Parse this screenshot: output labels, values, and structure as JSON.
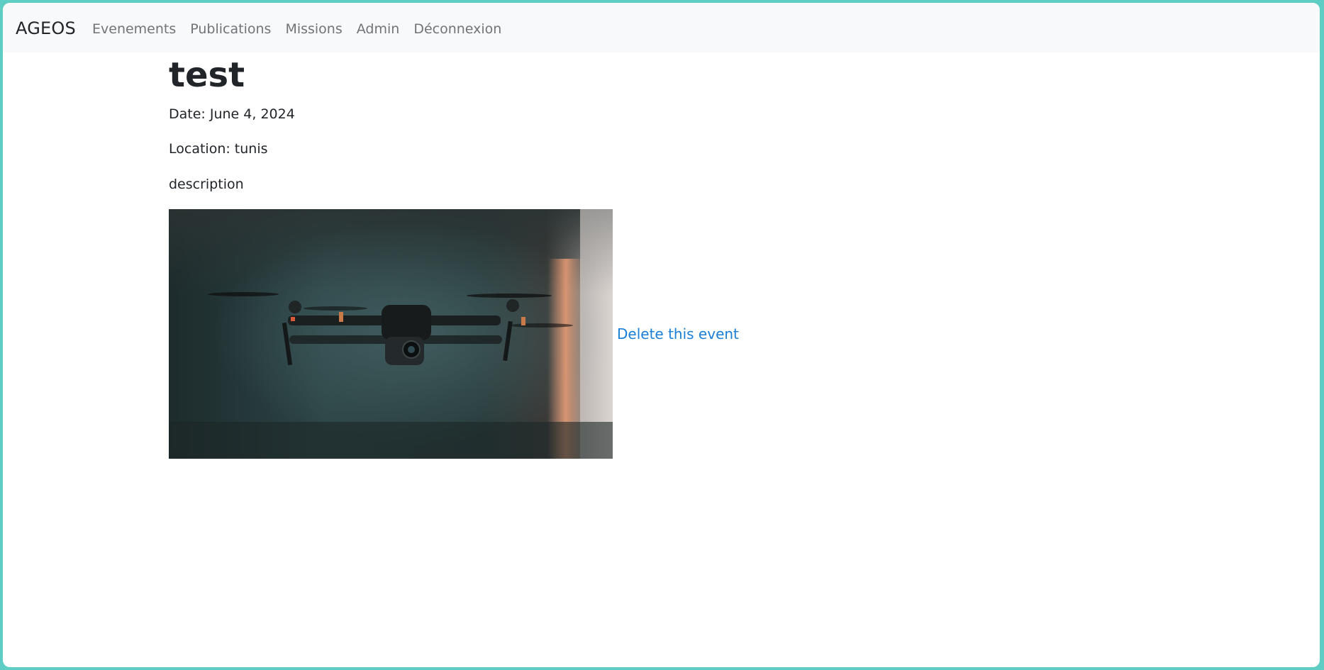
{
  "navbar": {
    "brand": "AGEOS",
    "links": [
      {
        "label": "Evenements"
      },
      {
        "label": "Publications"
      },
      {
        "label": "Missions"
      },
      {
        "label": "Admin"
      },
      {
        "label": "Déconnexion"
      }
    ]
  },
  "event": {
    "title": "test",
    "date": "Date: June 4, 2024",
    "location": "Location: tunis",
    "description": "description",
    "image_subject": "drone-photo",
    "delete_label": "Delete this event"
  },
  "colors": {
    "frame_border": "#5ecdc4",
    "navbar_bg": "#f8f9fa",
    "link": "#1a7fd6",
    "nav_text": "#707478",
    "text": "#212529"
  }
}
